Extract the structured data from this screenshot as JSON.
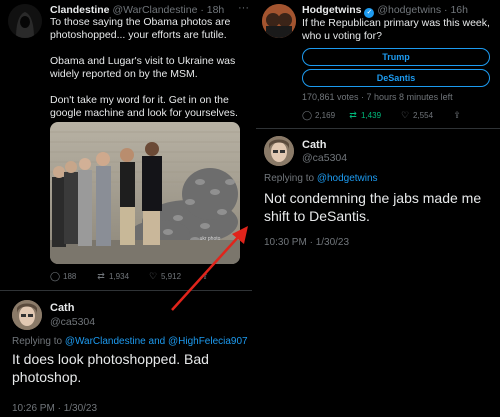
{
  "left_tweet": {
    "author_name": "Clandestine",
    "author_handle": "@WarClandestine",
    "time": "· 18h",
    "paragraphs": [
      "To those saying the Obama photos are photoshopped... your efforts are futile.",
      "Obama and Lugar's visit to Ukraine was widely reported on by the MSM.",
      "Don't take my word for it. Get in on the google machine and look for yourselves."
    ],
    "stats": {
      "replies": "188",
      "retweets": "1,934",
      "likes": "5,912"
    }
  },
  "left_reply": {
    "author_name": "Cath",
    "author_handle": "@ca5304",
    "replying_prefix": "Replying to",
    "replying_to": "@WarClandestine and @HighFelecia907",
    "text": "It does look photoshopped. Bad photoshop.",
    "timestamp": "10:26 PM · 1/30/23"
  },
  "right_tweet": {
    "author_name": "Hodgetwins",
    "author_handle": "@hodgetwins",
    "time": "· 16h",
    "text": "If the Republican primary was this week, who u voting for?",
    "poll_options": [
      "Trump",
      "DeSantis"
    ],
    "poll_meta": "170,861 votes · 7 hours 8 minutes left",
    "stats": {
      "replies": "2,169",
      "retweets": "1,439",
      "likes": "2,554"
    }
  },
  "right_reply": {
    "author_name": "Cath",
    "author_handle": "@ca5304",
    "replying_prefix": "Replying to",
    "replying_to": "@hodgetwins",
    "text": "Not condemning the jabs made me shift to DeSantis.",
    "timestamp": "10:30 PM · 1/30/23"
  },
  "icons": [
    "reply-icon",
    "retweet-icon",
    "like-icon",
    "share-icon",
    "more-icon"
  ],
  "colors": {
    "link": "#1d9bf0",
    "retweet_active": "#00ba7c",
    "arrow": "#e0241b",
    "background": "#000000"
  }
}
